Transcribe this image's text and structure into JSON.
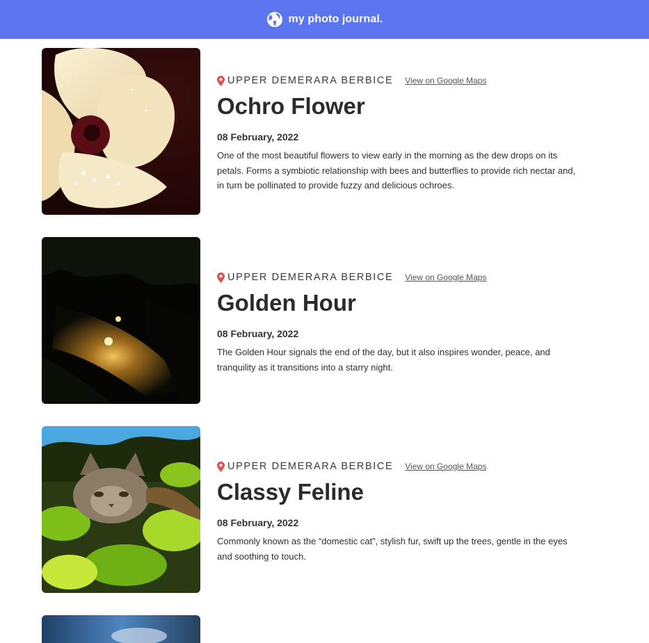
{
  "header": {
    "title": "my photo journal.",
    "icon": "globe-icon",
    "background": "#5b74f0"
  },
  "entries": [
    {
      "photo_icon": "flower-photo",
      "location": "Upper Demerara Berbice",
      "maps_link": "View on Google Maps",
      "title": "Ochro Flower",
      "date": "08 February, 2022",
      "description": "One of the most beautiful flowers to view early in the morning as the dew drops on its petals. Forms a symbiotic relationship with bees and butterflies to provide rich nectar and, in turn be pollinated to provide fuzzy and delicious ochroes."
    },
    {
      "photo_icon": "sunset-photo",
      "location": "Upper Demerara Berbice",
      "maps_link": "View on Google Maps",
      "title": "Golden Hour",
      "date": "08 February, 2022",
      "description": "The Golden Hour signals the end of the day, but it also inspires wonder, peace, and tranquility as it transitions into a starry night."
    },
    {
      "photo_icon": "cat-photo",
      "location": "Upper Demerara Berbice",
      "maps_link": "View on Google Maps",
      "title": "Classy Feline",
      "date": "08 February, 2022",
      "description": "Commonly known as the “domestic cat”, stylish fur, swift up the trees, gentle in the eyes and soothing to touch."
    }
  ],
  "colors": {
    "pin": "#e05252",
    "text": "#2b2b2b"
  }
}
